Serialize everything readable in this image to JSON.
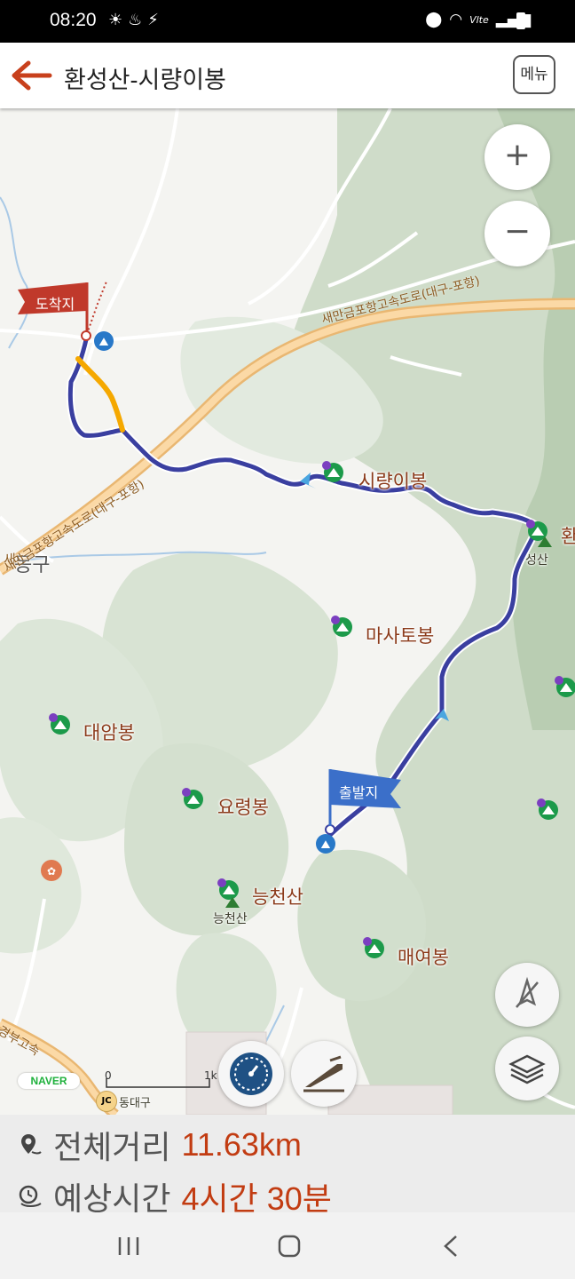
{
  "status_bar": {
    "time": "08:20",
    "network_label": "Vlte"
  },
  "app_bar": {
    "title": "환성산-시량이봉",
    "menu_label": "메뉴"
  },
  "map": {
    "start_flag": "출발지",
    "end_flag": "도착지",
    "peaks": [
      {
        "name": "시량이봉"
      },
      {
        "name": "마사토봉"
      },
      {
        "name": "대암봉"
      },
      {
        "name": "요령봉"
      },
      {
        "name": "능천산"
      },
      {
        "name": "매여봉"
      },
      {
        "name": "환"
      }
    ],
    "peak_small_labels": [
      "성산",
      "능천산"
    ],
    "district": "동구",
    "district_prefix": "새",
    "road_labels": [
      "새만금포항고속도로(대구-포항)",
      "새만금포항고속도로(대구-포항)",
      "경부고속"
    ],
    "naver_badge": "NAVER",
    "scale_start": "0",
    "scale_end": "1k",
    "jc_badge": "JC",
    "jc_label": "동대구",
    "zoom_in": "+",
    "zoom_out": "−"
  },
  "info": {
    "distance_label": "전체거리",
    "distance_value": "11.63km",
    "time_label": "예상시간",
    "time_value": "4시간 30분"
  },
  "colors": {
    "route": "#3a3fa0",
    "highlight": "#f5a800",
    "accent": "#c23c12",
    "flag_end": "#c0392b",
    "flag_start": "#3b6fc9"
  }
}
